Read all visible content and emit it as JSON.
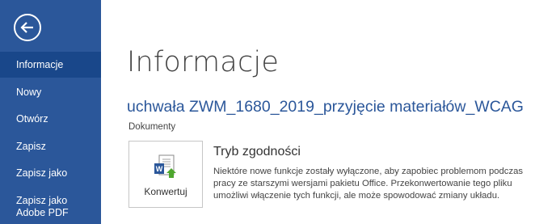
{
  "sidebar": {
    "items": [
      {
        "label": "Informacje",
        "selected": true
      },
      {
        "label": "Nowy"
      },
      {
        "label": "Otwórz"
      },
      {
        "label": "Zapisz"
      },
      {
        "label": "Zapisz jako"
      },
      {
        "label_line1": "Zapisz jako",
        "label_line2": "Adobe PDF"
      }
    ],
    "back_icon": "back-arrow-icon"
  },
  "main": {
    "title": "Informacje",
    "document_name": "uchwała ZWM_1680_2019_przyjęcie materiałów_WCAG",
    "document_location": "Dokumenty",
    "convert": {
      "label": "Konwertuj",
      "icon": "word-convert-icon"
    },
    "compat": {
      "title": "Tryb zgodności",
      "desc_lines": [
        "Niektóre nowe funkcje zostały wyłączone, aby zapobiec problemom podczas",
        "pracy ze starszymi wersjami pakietu Office. Przekonwertowanie tego pliku",
        "umożliwi włączenie tych funkcji, ale może spowodować zmiany układu."
      ]
    }
  },
  "colors": {
    "sidebar": "#2b579a",
    "sidebar_selected": "#19478a",
    "link": "#2b579a",
    "accent_green": "#4ea72e"
  }
}
